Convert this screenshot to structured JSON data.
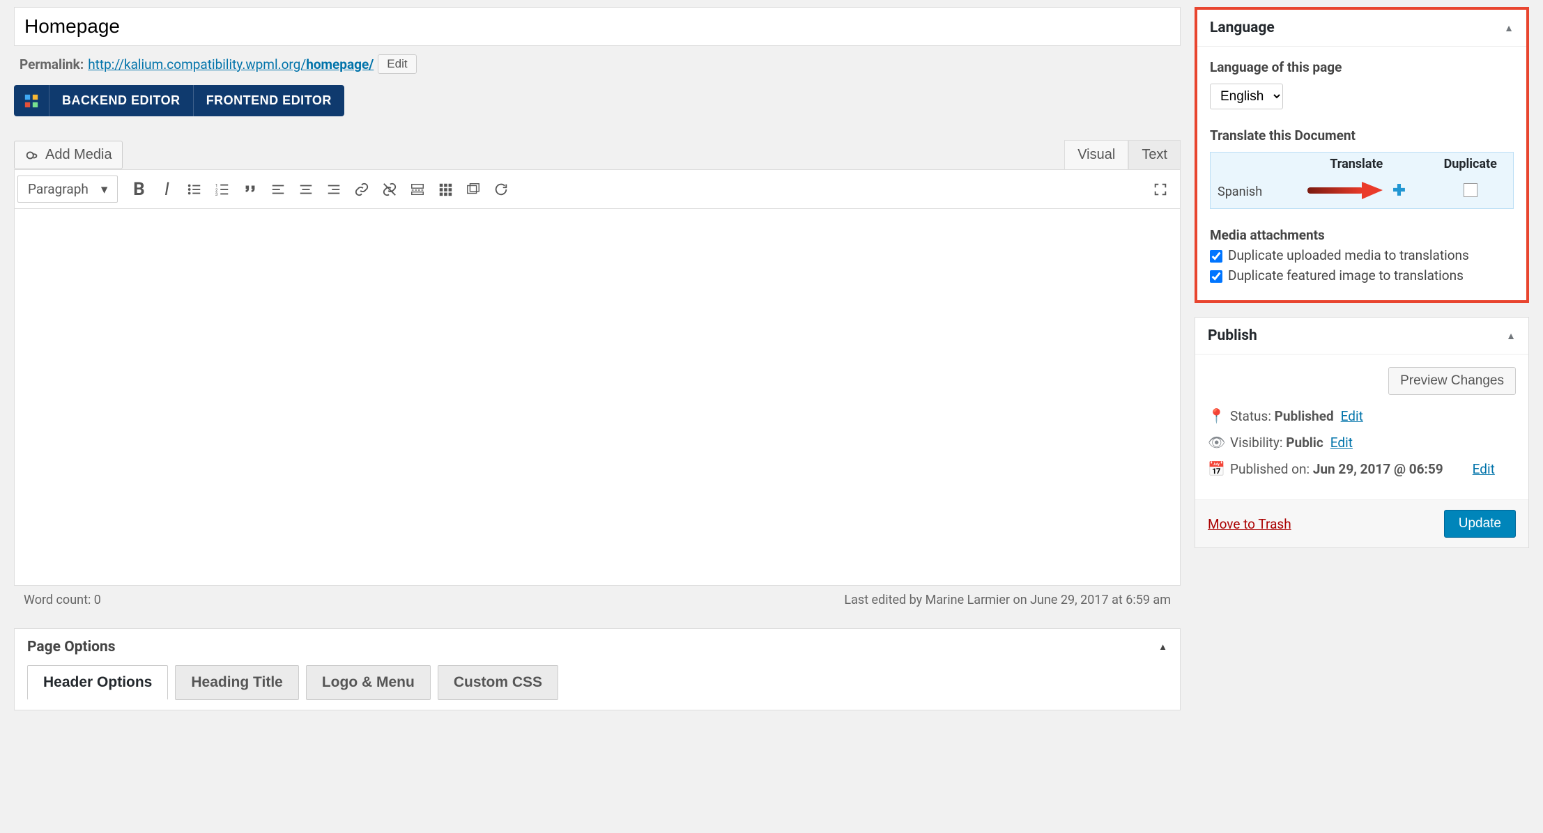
{
  "title": "Homepage",
  "permalink": {
    "label": "Permalink:",
    "base": "http://kalium.compatibility.wpml.org/",
    "slug": "homepage/",
    "edit_btn": "Edit"
  },
  "editor_buttons": {
    "backend": "BACKEND EDITOR",
    "frontend": "FRONTEND EDITOR"
  },
  "add_media": "Add Media",
  "editor_tabs": {
    "visual": "Visual",
    "text": "Text"
  },
  "paragraph_select": "Paragraph",
  "footer": {
    "word_count_label": "Word count: ",
    "word_count": "0",
    "last_edited": "Last edited by Marine Larmier on June 29, 2017 at 6:59 am"
  },
  "page_options": {
    "title": "Page Options",
    "tabs": [
      "Header Options",
      "Heading Title",
      "Logo & Menu",
      "Custom CSS"
    ]
  },
  "language_box": {
    "title": "Language",
    "lang_of_page": "Language of this page",
    "current_lang": "English",
    "translate_heading": "Translate this Document",
    "cols": {
      "translate": "Translate",
      "duplicate": "Duplicate"
    },
    "row_lang": "Spanish",
    "media_heading": "Media attachments",
    "dup_media": "Duplicate uploaded media to translations",
    "dup_featured": "Duplicate featured image to translations"
  },
  "publish_box": {
    "title": "Publish",
    "preview_btn": "Preview Changes",
    "status_label": "Status: ",
    "status_value": "Published",
    "edit": "Edit",
    "visibility_label": "Visibility: ",
    "visibility_value": "Public",
    "published_label": "Published on: ",
    "published_value": "Jun 29, 2017 @ 06:59",
    "trash": "Move to Trash",
    "update": "Update"
  }
}
